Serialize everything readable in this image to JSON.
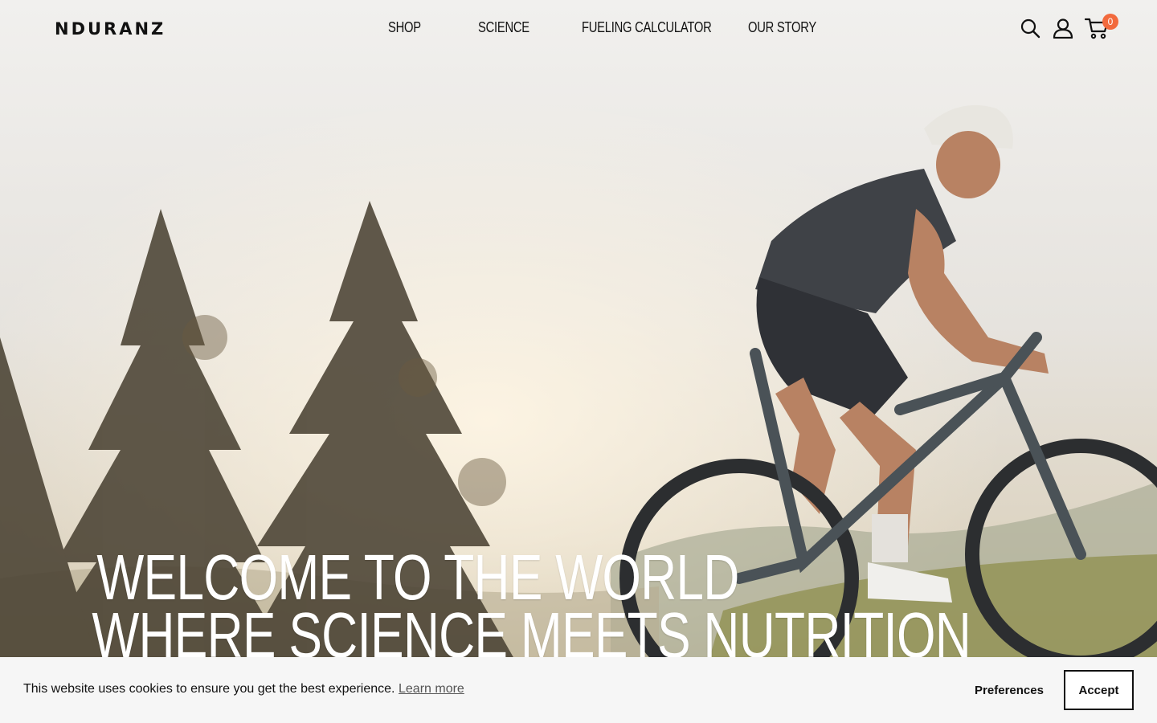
{
  "brand": {
    "logo_text": "NDURANZ"
  },
  "nav": {
    "items": [
      {
        "label": "SHOP"
      },
      {
        "label": "SCIENCE"
      },
      {
        "label": "FUELING CALCULATOR"
      },
      {
        "label": "OUR STORY"
      }
    ]
  },
  "header_icons": {
    "search": "search-icon",
    "account": "user-icon",
    "cart": "cart-icon",
    "cart_count": "0",
    "cart_badge_color": "#f26a3d"
  },
  "hero": {
    "headline_line1": "WELCOME TO THE WORLD",
    "headline_line2": "WHERE SCIENCE MEETS NUTRITION"
  },
  "cookie_banner": {
    "message": "This website uses cookies to ensure you get the best experience.",
    "learn_more": "Learn more",
    "preferences_label": "Preferences",
    "accept_label": "Accept"
  }
}
